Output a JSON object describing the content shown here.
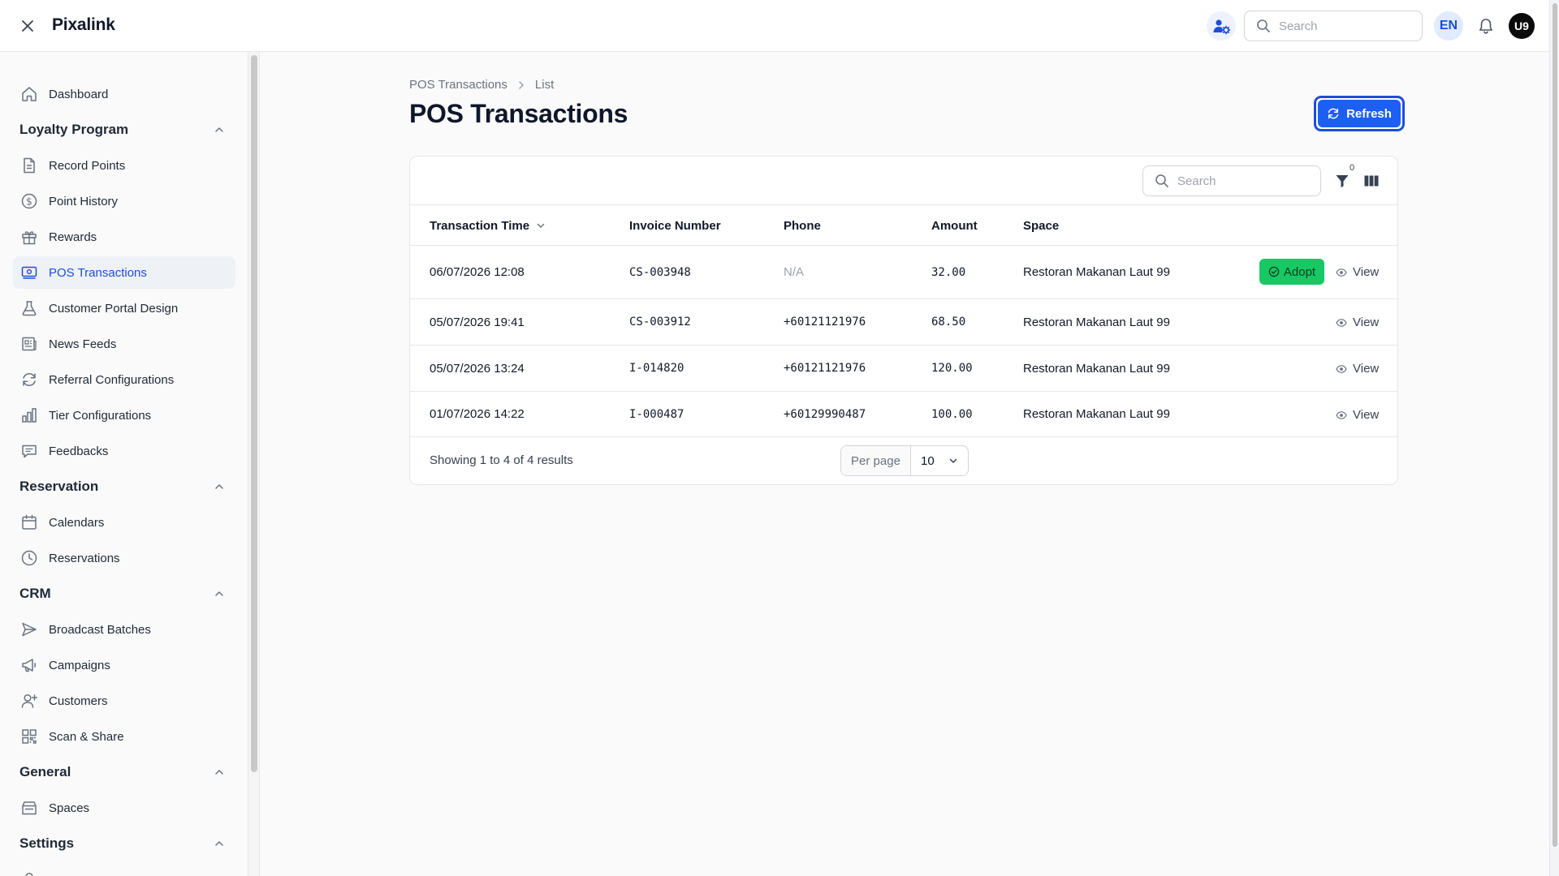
{
  "app": {
    "brand": "Pixalink",
    "search_placeholder": "Search",
    "language": "EN",
    "avatar_initials": "U9"
  },
  "sidebar": {
    "top_items": [
      {
        "label": "Dashboard",
        "icon": "home-icon"
      }
    ],
    "groups": [
      {
        "label": "Loyalty Program",
        "items": [
          {
            "label": "Record Points",
            "icon": "document-icon"
          },
          {
            "label": "Point History",
            "icon": "dollar-circle-icon"
          },
          {
            "label": "Rewards",
            "icon": "gift-icon"
          },
          {
            "label": "POS Transactions",
            "icon": "pos-icon",
            "active": true
          },
          {
            "label": "Customer Portal Design",
            "icon": "flask-icon"
          },
          {
            "label": "News Feeds",
            "icon": "newspaper-icon"
          },
          {
            "label": "Referral Configurations",
            "icon": "refresh-arrows-icon"
          },
          {
            "label": "Tier Configurations",
            "icon": "bar-chart-icon"
          },
          {
            "label": "Feedbacks",
            "icon": "chat-bubble-icon"
          }
        ]
      },
      {
        "label": "Reservation",
        "items": [
          {
            "label": "Calendars",
            "icon": "calendar-icon"
          },
          {
            "label": "Reservations",
            "icon": "clock-icon"
          }
        ]
      },
      {
        "label": "CRM",
        "items": [
          {
            "label": "Broadcast Batches",
            "icon": "send-icon"
          },
          {
            "label": "Campaigns",
            "icon": "megaphone-icon"
          },
          {
            "label": "Customers",
            "icon": "user-plus-icon"
          },
          {
            "label": "Scan & Share",
            "icon": "qr-code-icon"
          }
        ]
      },
      {
        "label": "General",
        "items": [
          {
            "label": "Spaces",
            "icon": "building-icon"
          }
        ]
      },
      {
        "label": "Settings",
        "items": []
      }
    ]
  },
  "page": {
    "breadcrumb": [
      "POS Transactions",
      "List"
    ],
    "title": "POS Transactions",
    "refresh_label": "Refresh"
  },
  "table": {
    "search_placeholder": "Search",
    "filter_count": "0",
    "columns": [
      "Transaction Time",
      "Invoice Number",
      "Phone",
      "Amount",
      "Space"
    ],
    "rows": [
      {
        "time": "06/07/2026 12:08",
        "invoice": "CS-003948",
        "phone": "N/A",
        "amount": "32.00",
        "space": "Restoran Makanan Laut 99",
        "adopt": "Adopt",
        "view": "View"
      },
      {
        "time": "05/07/2026 19:41",
        "invoice": "CS-003912",
        "phone": "+60121121976",
        "amount": "68.50",
        "space": "Restoran Makanan Laut 99",
        "view": "View"
      },
      {
        "time": "05/07/2026 13:24",
        "invoice": "I-014820",
        "phone": "+60121121976",
        "amount": "120.00",
        "space": "Restoran Makanan Laut 99",
        "view": "View"
      },
      {
        "time": "01/07/2026 14:22",
        "invoice": "I-000487",
        "phone": "+60129990487",
        "amount": "100.00",
        "space": "Restoran Makanan Laut 99",
        "view": "View"
      }
    ],
    "showing_text": "Showing 1 to 4 of 4 results",
    "per_page_label": "Per page",
    "per_page_value": "10"
  },
  "colors": {
    "accent": "#1d5ff3",
    "adopt_green": "#17c964",
    "active_nav_bg": "#eef1f6"
  }
}
